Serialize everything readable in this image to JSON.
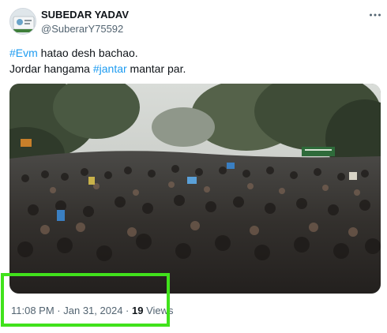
{
  "author": {
    "display_name": "SUBEDAR YADAV",
    "handle": "@SuberarY75592",
    "avatar_icon": "profile-avatar"
  },
  "more_icon": "ellipsis-icon",
  "tweet": {
    "line1": {
      "hashtag": "#Evm",
      "text": " hatao desh bachao."
    },
    "line2": {
      "text_before": "Jordar hangama ",
      "hashtag": "#jantar",
      "text_after": " mantar par."
    }
  },
  "media": {
    "type": "video",
    "scene": "crowd-protest"
  },
  "meta": {
    "time": "11:08 PM",
    "separator": " · ",
    "date": "Jan 31, 2024",
    "separator2": " · ",
    "views_count": "19",
    "views_label": " Views"
  },
  "colors": {
    "link": "#1d9bf0",
    "secondary_text": "#536471",
    "primary_text": "#0f1419",
    "highlight": "#41e21c"
  }
}
